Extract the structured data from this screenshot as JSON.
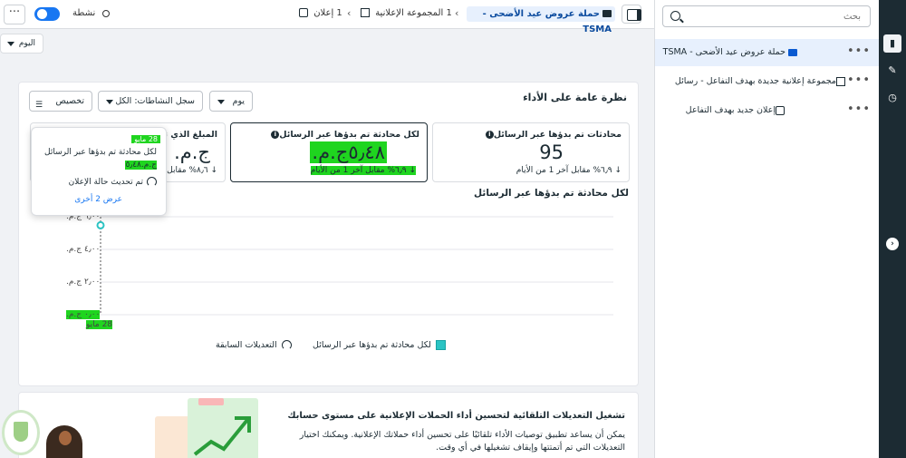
{
  "topbar": {
    "more_label": "···",
    "status_label": "نشطة",
    "crumb_ad": "1 إعلان",
    "crumb_adset": "1 المجموعة الإعلانية",
    "crumb_campaign": "حملة عروض عيد الأضحى - TSMA"
  },
  "day_dropdown": "اليوم",
  "overview": {
    "title": "نظرة عامة على الأداء",
    "customize_label": "تخصيص",
    "activity_log_label": "سجل النشاطات: الكل",
    "period_label": "يوم"
  },
  "metrics": [
    {
      "title": "محادثات تم بدؤها عبر الرسائل",
      "value": "95",
      "delta": "↓ ٦٫٩% مقابل آخر 1 من الأيام"
    },
    {
      "title": "لكل محادثة تم بدؤها عبر الرسائل",
      "value": "٥٫٤٨ج.م.‏",
      "delta": "↓ ٦٫٩% مقابل آخر 1 من الأيام"
    },
    {
      "title": "المبلغ الذي تم إنفاقه",
      "value": "ج.م.‏",
      "delta": "↓ ٨٫٦% مقابل"
    }
  ],
  "chart_data": {
    "type": "line",
    "title": "لكل محادثة تم بدؤها عبر الرسائل",
    "ytick_labels": [
      "٠٫٠٠ ج.م.",
      "٢٫٠٠ ج.م.",
      "٤٫٠٠ ج.م.",
      "٦٫٠٠ ج.م."
    ],
    "x": [
      "28 مايو"
    ],
    "series": [
      {
        "name": "لكل محادثة تم بدؤها عبر الرسائل",
        "values": [
          5.48
        ]
      }
    ],
    "legend": [
      "لكل محادثة تم بدؤها عبر الرسائل",
      "التعديلات السابقة"
    ],
    "colors": {
      "series": "#2bc4c4",
      "grid": "#e4e6eb"
    }
  },
  "tooltip": {
    "date": "28 مايو",
    "metric_label": "لكل محادثة تم بدؤها عبر الرسائل",
    "metric_value": "ج.م.‏٥٫٤٨",
    "event_label": "تم تحديث حالة الإعلان",
    "show_more": "عرض 2 أخرى"
  },
  "automation": {
    "title": "تشغيل التعديلات التلقائية لتحسين أداء الحملات الإعلانية على مستوى حسابك",
    "body": "يمكن أن يساعد تطبيق توصيات الأداء تلقائيًا على تحسين أداء حملاتك الإعلانية. ويمكنك اختيار التعديلات التي تم أتمتتها وإيقاف تشغيلها في أي وقت."
  },
  "panel": {
    "search_placeholder": "بحث",
    "items": [
      {
        "label": "حملة عروض عيد الأضحى - TSMA",
        "icon": "folder-icon"
      },
      {
        "label": "مجموعة إعلانية جديدة بهدف التفاعل - رسائل",
        "icon": "grid-icon"
      },
      {
        "label": "إعلان جديد بهدف التفاعل",
        "icon": "ad-icon"
      }
    ],
    "dots": "•••"
  },
  "vbar": {
    "icons": [
      "bar-chart-icon",
      "pencil-icon",
      "history-icon",
      "expand-icon"
    ]
  }
}
